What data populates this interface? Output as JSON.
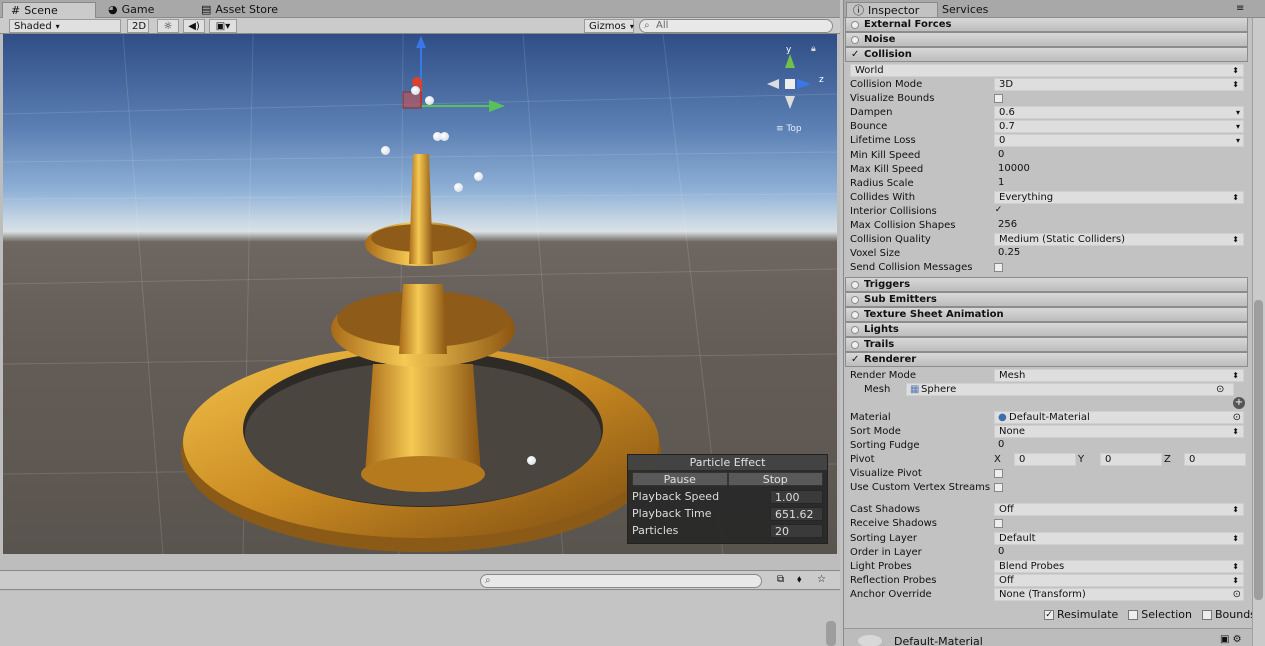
{
  "scene_panel": {
    "tabs": [
      {
        "label": "Scene",
        "icon": "grid-icon"
      },
      {
        "label": "Game",
        "icon": "pacman-icon"
      },
      {
        "label": "Asset Store",
        "icon": "bag-icon"
      }
    ],
    "toolbar": {
      "shading_mode": "Shaded",
      "mode_2d": "2D",
      "gizmos": "Gizmos",
      "search_placeholder": "All"
    },
    "gizmo_labels": {
      "x": "x",
      "y": "y",
      "z": "z",
      "view": "Top"
    }
  },
  "particle_effect": {
    "title": "Particle Effect",
    "pause_label": "Pause",
    "stop_label": "Stop",
    "rows": [
      {
        "label": "Playback Speed",
        "value": "1.00"
      },
      {
        "label": "Playback Time",
        "value": "651.62"
      },
      {
        "label": "Particles",
        "value": "20"
      }
    ]
  },
  "inspector": {
    "tabs": [
      "Inspector",
      "Services"
    ],
    "collapsed_modules_top": [
      "External Forces",
      "Noise"
    ],
    "collision": {
      "header": "Collision",
      "type": "World",
      "props": [
        {
          "label": "Collision Mode",
          "value": "3D",
          "kind": "pop"
        },
        {
          "label": "Visualize Bounds",
          "value": "",
          "kind": "check"
        },
        {
          "label": "Dampen",
          "value": "0.6",
          "kind": "curve"
        },
        {
          "label": "Bounce",
          "value": "0.7",
          "kind": "curve"
        },
        {
          "label": "Lifetime Loss",
          "value": "0",
          "kind": "curve"
        },
        {
          "label": "Min Kill Speed",
          "value": "0",
          "kind": "field"
        },
        {
          "label": "Max Kill Speed",
          "value": "10000",
          "kind": "field"
        },
        {
          "label": "Radius Scale",
          "value": "1",
          "kind": "field"
        },
        {
          "label": "Collides With",
          "value": "Everything",
          "kind": "pop"
        },
        {
          "label": "Interior Collisions",
          "value": "✓",
          "kind": "check"
        },
        {
          "label": "Max Collision Shapes",
          "value": "256",
          "kind": "field"
        },
        {
          "label": "Collision Quality",
          "value": "Medium (Static Colliders)",
          "kind": "pop"
        },
        {
          "label": "Voxel Size",
          "value": "0.25",
          "kind": "field"
        },
        {
          "label": "Send Collision Messages",
          "value": "",
          "kind": "check"
        }
      ]
    },
    "collapsed_modules_mid": [
      "Triggers",
      "Sub Emitters",
      "Texture Sheet Animation",
      "Lights",
      "Trails"
    ],
    "renderer": {
      "header": "Renderer",
      "render_mode": {
        "label": "Render Mode",
        "value": "Mesh"
      },
      "mesh": {
        "label": "Mesh",
        "value": "Sphere"
      },
      "material": {
        "label": "Material",
        "value": "Default-Material"
      },
      "sort_mode": {
        "label": "Sort Mode",
        "value": "None"
      },
      "sorting_fudge": {
        "label": "Sorting Fudge",
        "value": "0"
      },
      "pivot": {
        "label": "Pivot",
        "x_label": "X",
        "x": "0",
        "y_label": "Y",
        "y": "0",
        "z_label": "Z",
        "z": "0"
      },
      "visualize_pivot": {
        "label": "Visualize Pivot"
      },
      "custom_streams": {
        "label": "Use Custom Vertex Streams"
      },
      "cast_shadows": {
        "label": "Cast Shadows",
        "value": "Off"
      },
      "receive_shadows": {
        "label": "Receive Shadows"
      },
      "sorting_layer": {
        "label": "Sorting Layer",
        "value": "Default"
      },
      "order_in_layer": {
        "label": "Order in Layer",
        "value": "0"
      },
      "light_probes": {
        "label": "Light Probes",
        "value": "Blend Probes"
      },
      "reflection_probes": {
        "label": "Reflection Probes",
        "value": "Off"
      },
      "anchor_override": {
        "label": "Anchor Override",
        "value": "None (Transform)"
      }
    },
    "bottom": {
      "resimulate": "Resimulate",
      "selection": "Selection",
      "bounds": "Bounds",
      "material_preview": "Default-Material"
    }
  }
}
